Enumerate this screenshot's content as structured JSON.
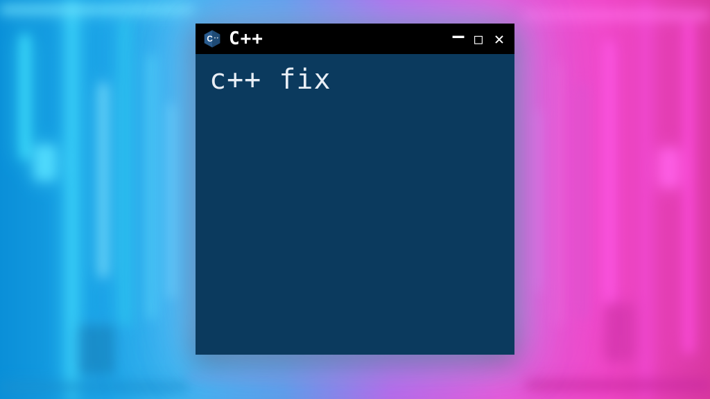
{
  "window": {
    "title": "C++",
    "icon_name": "cpp-hexagon-icon",
    "body_text": "c++ fix",
    "colors": {
      "titlebar_bg": "#000000",
      "body_bg": "#0b3a5e",
      "text": "#e8eef5"
    },
    "controls": {
      "minimize_glyph": "—",
      "maximize_glyph": "□",
      "close_glyph": "✕"
    }
  }
}
